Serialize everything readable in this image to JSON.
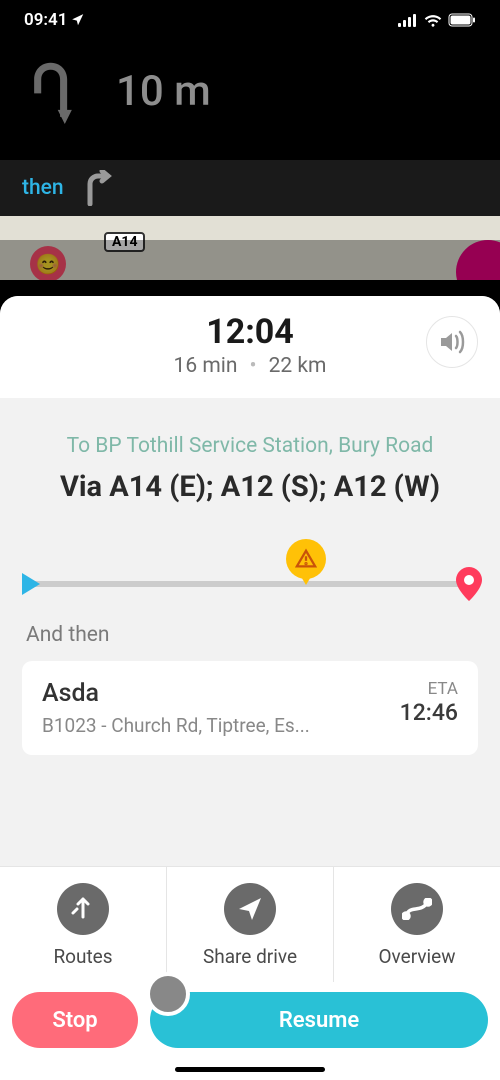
{
  "status": {
    "time": "09:41"
  },
  "nav": {
    "distance": "10 m",
    "then_label": "then",
    "map_road": "A14"
  },
  "trip": {
    "arrival": "12:04",
    "duration": "16 min",
    "distance": "22 km",
    "destination_prefix": "To BP Tothill Service Station, Bury Road",
    "via": "Via A14 (E); A12 (S); A12 (W)"
  },
  "next": {
    "heading": "And then",
    "name": "Asda",
    "address": "B1023 - Church Rd, Tiptree, Es...",
    "eta_label": "ETA",
    "eta_time": "12:46"
  },
  "actions": {
    "routes": "Routes",
    "share": "Share drive",
    "overview": "Overview"
  },
  "buttons": {
    "stop": "Stop",
    "resume": "Resume"
  }
}
